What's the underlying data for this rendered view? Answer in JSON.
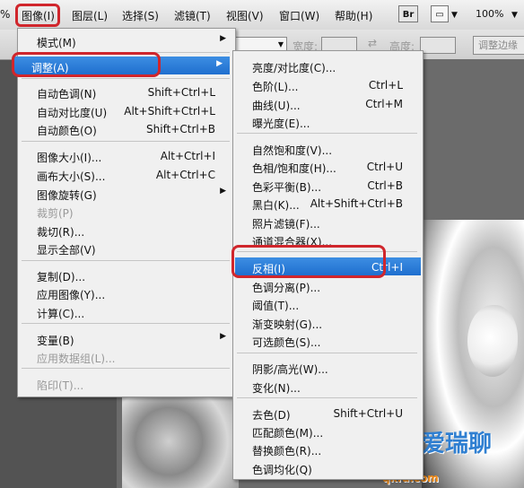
{
  "menubar": {
    "first_fragment": "%",
    "items": [
      "图像(I)",
      "图层(L)",
      "选择(S)",
      "滤镜(T)",
      "视图(V)",
      "窗口(W)",
      "帮助(H)"
    ],
    "br_icon": "Br",
    "zoom": "100%"
  },
  "optionsbar": {
    "width_label": "宽度:",
    "height_label": "高度:",
    "swap_icon": "⇄",
    "adjust_edge_button": "调整边缘"
  },
  "image_menu": {
    "items": [
      {
        "label": "模式(M)",
        "shortcut": "",
        "submenu": true,
        "disabled": false
      },
      {
        "label": "调整(A)",
        "shortcut": "",
        "submenu": true,
        "disabled": false,
        "selected": true
      },
      {
        "label": "自动色调(N)",
        "shortcut": "Shift+Ctrl+L",
        "submenu": false,
        "disabled": false
      },
      {
        "label": "自动对比度(U)",
        "shortcut": "Alt+Shift+Ctrl+L",
        "submenu": false,
        "disabled": false
      },
      {
        "label": "自动颜色(O)",
        "shortcut": "Shift+Ctrl+B",
        "submenu": false,
        "disabled": false
      },
      {
        "label": "图像大小(I)...",
        "shortcut": "Alt+Ctrl+I",
        "submenu": false,
        "disabled": false
      },
      {
        "label": "画布大小(S)...",
        "shortcut": "Alt+Ctrl+C",
        "submenu": false,
        "disabled": false
      },
      {
        "label": "图像旋转(G)",
        "shortcut": "",
        "submenu": true,
        "disabled": false
      },
      {
        "label": "裁剪(P)",
        "shortcut": "",
        "submenu": false,
        "disabled": true
      },
      {
        "label": "裁切(R)...",
        "shortcut": "",
        "submenu": false,
        "disabled": false
      },
      {
        "label": "显示全部(V)",
        "shortcut": "",
        "submenu": false,
        "disabled": false
      },
      {
        "label": "复制(D)...",
        "shortcut": "",
        "submenu": false,
        "disabled": false
      },
      {
        "label": "应用图像(Y)...",
        "shortcut": "",
        "submenu": false,
        "disabled": false
      },
      {
        "label": "计算(C)...",
        "shortcut": "",
        "submenu": false,
        "disabled": false
      },
      {
        "label": "变量(B)",
        "shortcut": "",
        "submenu": true,
        "disabled": false
      },
      {
        "label": "应用数据组(L)...",
        "shortcut": "",
        "submenu": false,
        "disabled": true
      },
      {
        "label": "陷印(T)...",
        "shortcut": "",
        "submenu": false,
        "disabled": true
      }
    ]
  },
  "adjust_menu": {
    "items": [
      {
        "label": "亮度/对比度(C)...",
        "shortcut": ""
      },
      {
        "label": "色阶(L)...",
        "shortcut": "Ctrl+L"
      },
      {
        "label": "曲线(U)...",
        "shortcut": "Ctrl+M"
      },
      {
        "label": "曝光度(E)...",
        "shortcut": ""
      },
      {
        "label": "自然饱和度(V)...",
        "shortcut": ""
      },
      {
        "label": "色相/饱和度(H)...",
        "shortcut": "Ctrl+U"
      },
      {
        "label": "色彩平衡(B)...",
        "shortcut": "Ctrl+B"
      },
      {
        "label": "黑白(K)...",
        "shortcut": "Alt+Shift+Ctrl+B"
      },
      {
        "label": "照片滤镜(F)...",
        "shortcut": ""
      },
      {
        "label": "通道混合器(X)...",
        "shortcut": ""
      },
      {
        "label": "反相(I)",
        "shortcut": "Ctrl+I",
        "selected": true
      },
      {
        "label": "色调分离(P)...",
        "shortcut": ""
      },
      {
        "label": "阈值(T)...",
        "shortcut": ""
      },
      {
        "label": "渐变映射(G)...",
        "shortcut": ""
      },
      {
        "label": "可选颜色(S)...",
        "shortcut": ""
      },
      {
        "label": "阴影/高光(W)...",
        "shortcut": ""
      },
      {
        "label": "变化(N)...",
        "shortcut": ""
      },
      {
        "label": "去色(D)",
        "shortcut": "Shift+Ctrl+U"
      },
      {
        "label": "匹配颜色(M)...",
        "shortcut": ""
      },
      {
        "label": "替换颜色(R)...",
        "shortcut": ""
      },
      {
        "label": "色调均化(Q)",
        "shortcut": ""
      }
    ]
  },
  "watermark": {
    "text": "爱瑞聊",
    "url": "qkfu.com"
  },
  "colors": {
    "highlight_red": "#d0262c",
    "selection_blue": "#1f6fcf"
  }
}
